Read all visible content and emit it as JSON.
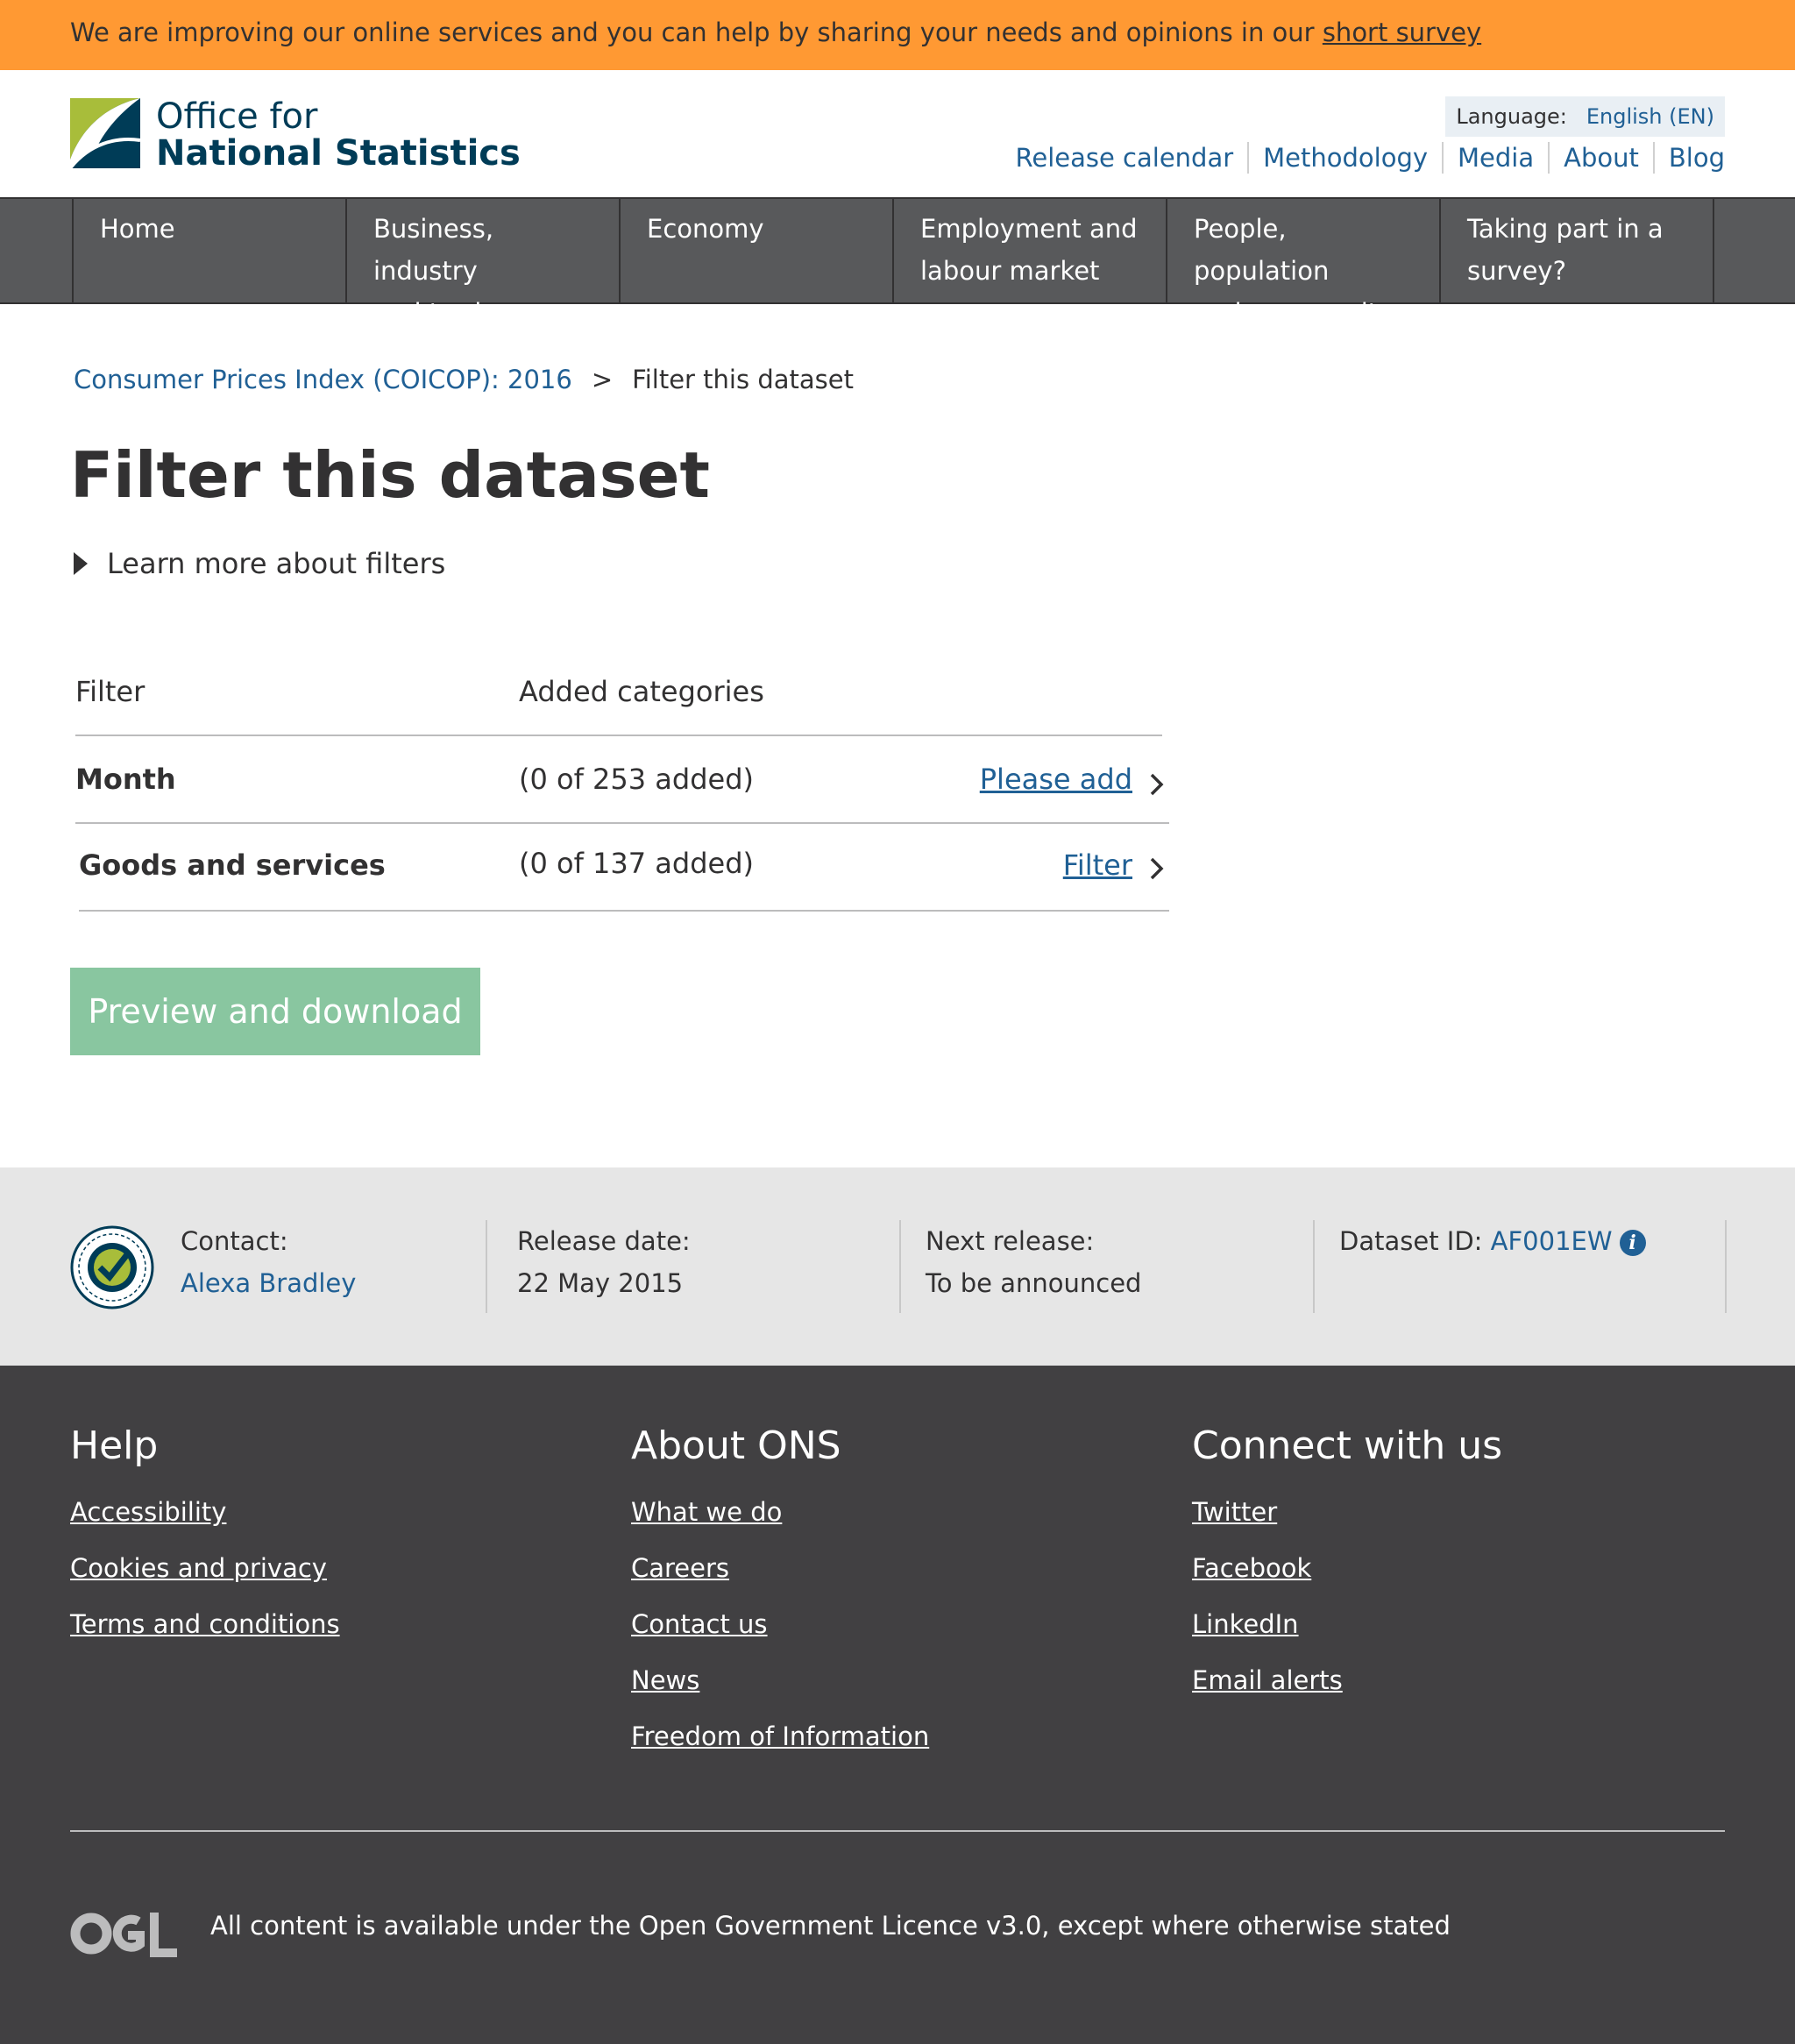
{
  "banner": {
    "text": "We are improving our online services and you can help by sharing your needs and opinions in our ",
    "link": "short survey"
  },
  "header": {
    "logo_line1": "Office for",
    "logo_line2": "National Statistics",
    "language_label": "Language:",
    "language_value": "English (EN)",
    "links": [
      "Release calendar",
      "Methodology",
      "Media",
      "About",
      "Blog"
    ]
  },
  "nav": {
    "items": [
      [
        "Home",
        ""
      ],
      [
        "Business, industry",
        "and trade"
      ],
      [
        "Economy",
        ""
      ],
      [
        "Employment and",
        "labour market"
      ],
      [
        "People, population",
        "and community"
      ],
      [
        "Taking part in a",
        "survey?"
      ]
    ]
  },
  "breadcrumb": {
    "parent": "Consumer Prices Index (COICOP): 2016",
    "separator": ">",
    "current": "Filter this dataset"
  },
  "page_title": "Filter this dataset",
  "details_summary": "Learn more about filters",
  "filter_table": {
    "headers": [
      "Filter",
      "Added categories"
    ],
    "rows": [
      {
        "label": "Month",
        "count": "(0 of 253 added)",
        "action": "Please add"
      },
      {
        "label": "Goods and services",
        "count": "(0 of 137 added)",
        "action": "Filter"
      }
    ]
  },
  "preview_button": "Preview and download",
  "meta": {
    "contact_label": "Contact:",
    "contact_value": "Alexa Bradley",
    "release_label": "Release date:",
    "release_value": "22 May 2015",
    "next_label": "Next release:",
    "next_value": "To be announced",
    "dataset_label": "Dataset ID: ",
    "dataset_value": "AF001EW",
    "info_glyph": "i"
  },
  "footer": {
    "help_heading": "Help",
    "help_links": [
      "Accessibility",
      "Cookies and privacy",
      "Terms and conditions"
    ],
    "about_heading": "About ONS",
    "about_links": [
      "What we do",
      "Careers",
      "Contact us",
      "News",
      "Freedom of Information"
    ],
    "connect_heading": "Connect with us",
    "connect_links": [
      "Twitter",
      "Facebook",
      "LinkedIn",
      "Email alerts"
    ],
    "licence": "All content is available under the Open Government Licence v3.0, except where otherwise stated"
  },
  "colors": {
    "banner": "#ff9933",
    "link": "#206095",
    "nav": "#58595b",
    "button": "#89c6a0",
    "meta_band": "#e6e6e6",
    "footer": "#414042"
  }
}
